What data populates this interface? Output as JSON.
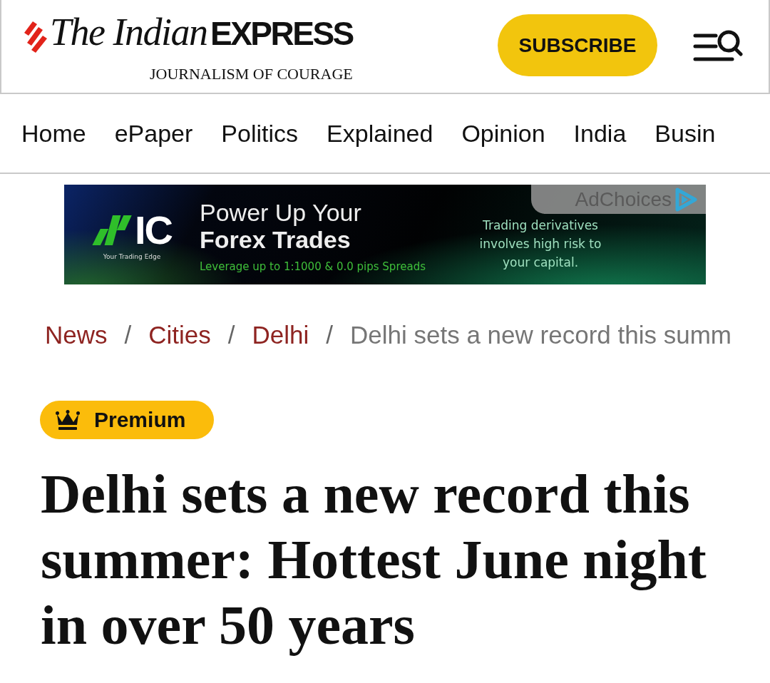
{
  "header": {
    "logo": {
      "title": "The Indian",
      "title_bold": "EXPRESS",
      "tagline": "JOURNALISM OF COURAGE"
    },
    "subscribe_button": "SUBSCRIBE"
  },
  "nav": {
    "items": [
      "Home",
      "ePaper",
      "Politics",
      "Explained",
      "Opinion",
      "India",
      "Busin"
    ]
  },
  "ad": {
    "logo_text": "IC",
    "logo_tagline": "Your Trading Edge",
    "headline": "Power Up Your **Forex Trades**",
    "subline": "Leverage up to 1:1000 & 0.0 pips Spreads",
    "disclaimer": "Trading derivatives involves high risk to your capital.",
    "adchoices": "AdChoices"
  },
  "breadcrumb": [
    {
      "kind": "link",
      "label": "News"
    },
    {
      "kind": "separator",
      "label": "/"
    },
    {
      "kind": "link",
      "label": "Cities"
    },
    {
      "kind": "separator",
      "label": "/"
    },
    {
      "kind": "link",
      "label": "Delhi"
    },
    {
      "kind": "separator",
      "label": "/"
    },
    {
      "kind": "current",
      "label": "Delhi sets a new record this summ"
    }
  ],
  "article": {
    "badge": "Premium",
    "headline": "Delhi sets a new record this summer: Hottest June night in over 50 years"
  }
}
